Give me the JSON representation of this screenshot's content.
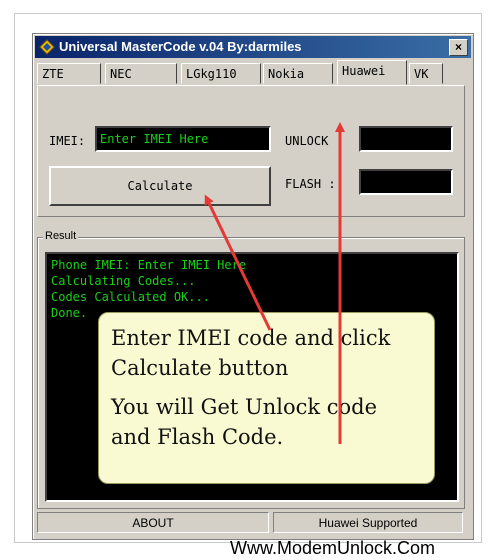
{
  "window": {
    "title": "Universal MasterCode v.04 By:darmiles",
    "close_label": "×"
  },
  "tabs": [
    "ZTE",
    "NEC",
    "LGkg110",
    "Nokia",
    "Huawei",
    "VK"
  ],
  "active_tab": "Huawei",
  "form": {
    "imei_label": "IMEI:",
    "imei_value": "Enter IMEI Here",
    "calculate_label": "Calculate",
    "unlock_label": "UNLOCK :",
    "unlock_value": "",
    "flash_label": "FLASH :",
    "flash_value": ""
  },
  "result": {
    "group_label": "Result",
    "lines": [
      "Phone IMEI: Enter IMEI Here",
      "Calculating Codes...",
      "Codes Calculated OK...",
      "Done."
    ]
  },
  "status_bar": {
    "about_label": "ABOUT",
    "supported_label": "Huawei Supported"
  },
  "annotation": {
    "line1": "Enter IMEI code and click Calculate button",
    "line2": "You will Get Unlock code and Flash Code."
  },
  "watermark": "Www.ModemUnlock.Com",
  "colors": {
    "lcd_text": "#18d018",
    "arrow": "#e53935",
    "title_bar": "#0a246a",
    "note_bg": "#fafad2"
  }
}
